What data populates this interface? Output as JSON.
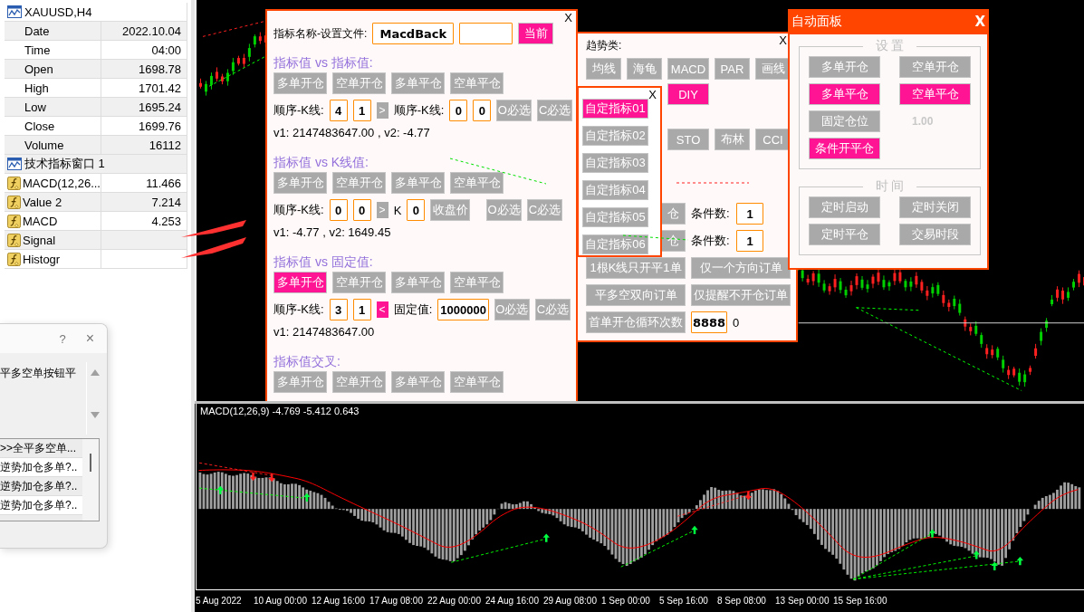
{
  "data_window": {
    "symbol": "XAUUSD,H4",
    "rows": [
      {
        "name": "Date",
        "value": "2022.10.04"
      },
      {
        "name": "Time",
        "value": "04:00"
      },
      {
        "name": "Open",
        "value": "1698.78"
      },
      {
        "name": "High",
        "value": "1701.42"
      },
      {
        "name": "Low",
        "value": "1695.24"
      },
      {
        "name": "Close",
        "value": "1699.76"
      },
      {
        "name": "Volume",
        "value": "16112"
      }
    ],
    "indicator_window": "技术指标窗口 1",
    "indicator_rows": [
      {
        "name": "MACD(12,26...",
        "value": "11.466"
      },
      {
        "name": "Value 2",
        "value": "7.214"
      },
      {
        "name": "MACD",
        "value": "4.253"
      },
      {
        "name": "Signal"
      },
      {
        "name": "Histogr"
      }
    ]
  },
  "list_dialog": {
    "help": "?",
    "close": "×",
    "description": "平多空单按钮平",
    "items": [
      ">>全平多空单...",
      "逆势加仓多单?..",
      "逆势加仓多单?..",
      "逆势加仓多单?.."
    ]
  },
  "indicator_dialog": {
    "close": "X",
    "name_label": "指标名称-设置文件:",
    "name_value": "MacdBack",
    "current_button": {
      "label": "当前",
      "selected": true
    },
    "sections": [
      {
        "heading": "指标值 vs 指标值:",
        "actions": [
          {
            "label": "多单开仓",
            "selected": false
          },
          {
            "label": "空单开仓",
            "selected": false
          },
          {
            "label": "多单平仓",
            "selected": false
          },
          {
            "label": "空单平仓",
            "selected": false
          }
        ],
        "row": {
          "items": [
            {
              "kind": "label",
              "text": "顺序-K线:"
            },
            {
              "kind": "field",
              "value": "4"
            },
            {
              "kind": "field",
              "value": "1"
            },
            {
              "kind": "toggle",
              "label": ">",
              "selected": false
            },
            {
              "kind": "label",
              "text": "顺序-K线:"
            },
            {
              "kind": "field",
              "value": "0"
            },
            {
              "kind": "field",
              "value": "0"
            }
          ],
          "options": [
            "O必选",
            "C必选"
          ]
        },
        "readout": "v1: 2147483647.00 , v2: -4.77"
      },
      {
        "heading": "指标值 vs K线值:",
        "actions": [
          {
            "label": "多单开仓",
            "selected": false
          },
          {
            "label": "空单开仓",
            "selected": false
          },
          {
            "label": "多单平仓",
            "selected": false
          },
          {
            "label": "空单平仓",
            "selected": false
          }
        ],
        "row": {
          "items": [
            {
              "kind": "label",
              "text": "顺序-K线:"
            },
            {
              "kind": "field",
              "value": "0"
            },
            {
              "kind": "field",
              "value": "0"
            },
            {
              "kind": "toggle",
              "label": ">",
              "selected": false
            },
            {
              "kind": "label",
              "text": "K"
            },
            {
              "kind": "field",
              "value": "0"
            },
            {
              "kind": "button",
              "label": "收盘价"
            }
          ],
          "options": [
            "O必选",
            "C必选"
          ]
        },
        "readout": "v1: -4.77 , v2: 1649.45"
      },
      {
        "heading": "指标值 vs 固定值:",
        "actions": [
          {
            "label": "多单开仓",
            "selected": true
          },
          {
            "label": "空单开仓",
            "selected": false
          },
          {
            "label": "多单平仓",
            "selected": false
          },
          {
            "label": "空单平仓",
            "selected": false
          }
        ],
        "row": {
          "items": [
            {
              "kind": "label",
              "text": "顺序-K线:"
            },
            {
              "kind": "field",
              "value": "3"
            },
            {
              "kind": "field",
              "value": "1"
            },
            {
              "kind": "toggle",
              "label": "<",
              "selected": true
            },
            {
              "kind": "label",
              "text": "固定值:"
            },
            {
              "kind": "field",
              "value": "1000000"
            }
          ],
          "options": [
            "O必选",
            "C必选"
          ]
        },
        "readout": "v1: 2147483647.00"
      },
      {
        "heading": "指标值交叉:",
        "actions": [
          {
            "label": "多单开仓",
            "selected": false
          },
          {
            "label": "空单开仓",
            "selected": false
          },
          {
            "label": "多单平仓",
            "selected": false
          },
          {
            "label": "空单平仓",
            "selected": false
          }
        ]
      }
    ]
  },
  "trend_dialog": {
    "close": "X",
    "heading": "趋势类:",
    "rows": [
      [
        {
          "label": "均线",
          "selected": false
        },
        {
          "label": "海龟",
          "selected": false
        },
        {
          "label": "MACD",
          "selected": false
        },
        {
          "label": "PAR",
          "selected": false
        },
        {
          "label": "画线",
          "selected": false
        }
      ],
      [
        null,
        null,
        {
          "label": "DIY",
          "selected": true
        }
      ],
      [
        null,
        null,
        {
          "label": "STO",
          "selected": false
        },
        {
          "label": "布林",
          "selected": false
        },
        {
          "label": "CCI",
          "selected": false
        }
      ]
    ],
    "conditions": [
      {
        "label": "仓",
        "count_label": "条件数:",
        "count": "1"
      },
      {
        "label": "仓",
        "count_label": "条件数:",
        "count": "1"
      }
    ],
    "options": [
      [
        "1根K线只开平1单",
        "仅一个方向订单"
      ],
      [
        "平多空双向订单",
        "仅提醒不开仓订单"
      ]
    ],
    "loop": {
      "label": "首单开仓循环次数",
      "value": "8888",
      "count": "0"
    }
  },
  "custom_popup": {
    "close": "X",
    "items": [
      {
        "label": "自定指标01",
        "selected": true
      },
      {
        "label": "自定指标02",
        "selected": false
      },
      {
        "label": "自定指标03",
        "selected": false
      },
      {
        "label": "自定指标04",
        "selected": false
      },
      {
        "label": "自定指标05",
        "selected": false
      },
      {
        "label": "自定指标06",
        "selected": false
      }
    ]
  },
  "auto_panel": {
    "title": "自动面板",
    "close": "X",
    "groups": [
      {
        "legend": "设 置",
        "items": [
          {
            "kind": "button",
            "label": "多单开仓",
            "selected": false
          },
          {
            "kind": "button",
            "label": "空单开仓",
            "selected": false
          },
          {
            "kind": "button",
            "label": "多单平仓",
            "selected": true
          },
          {
            "kind": "button",
            "label": "空单平仓",
            "selected": true
          },
          {
            "kind": "button",
            "label": "固定仓位",
            "selected": false
          },
          {
            "kind": "value",
            "text": "1.00"
          },
          {
            "kind": "button",
            "label": "条件开平仓",
            "selected": true
          }
        ]
      },
      {
        "legend": "时 间",
        "items": [
          {
            "kind": "button",
            "label": "定时启动",
            "selected": false
          },
          {
            "kind": "button",
            "label": "定时关闭",
            "selected": false
          },
          {
            "kind": "button",
            "label": "定时平仓",
            "selected": false
          },
          {
            "kind": "button",
            "label": "交易时段",
            "selected": false
          }
        ]
      }
    ]
  },
  "macd_panel": {
    "label": "MACD(12,26,9) -4.769 -5.412 0.643",
    "time_axis": [
      "5 Aug 2022",
      "10 Aug 00:00",
      "12 Aug 16:00",
      "17 Aug 08:00",
      "22 Aug 00:00",
      "24 Aug 16:00",
      "29 Aug 08:00",
      "1 Sep 00:00",
      "5 Sep 16:00",
      "8 Sep 08:00",
      "13 Sep 00:00",
      "15 Sep 16:00"
    ]
  }
}
